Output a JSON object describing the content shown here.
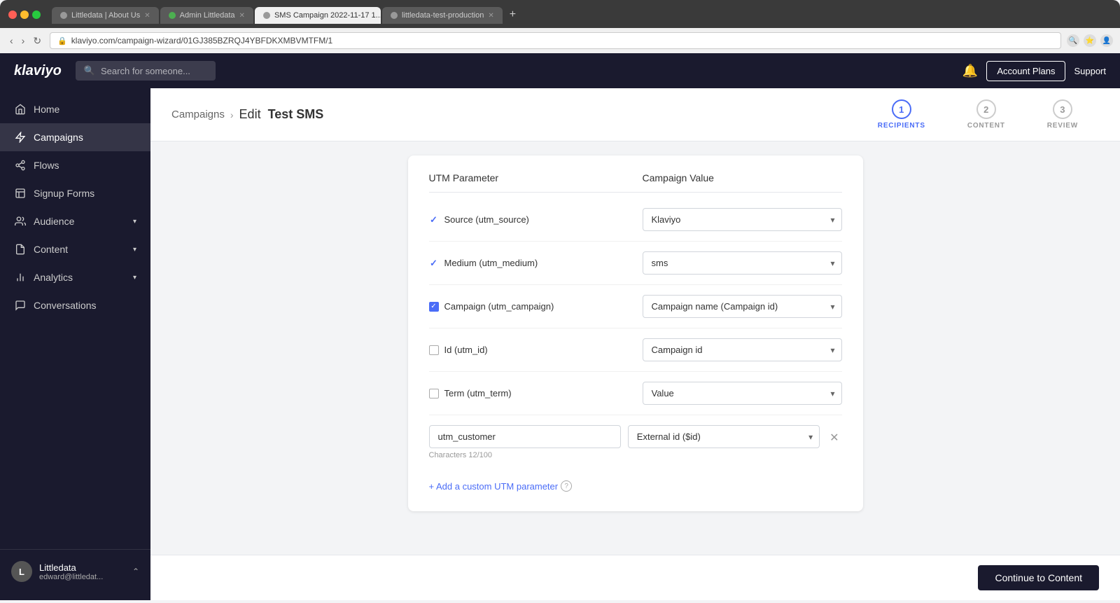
{
  "browser": {
    "tabs": [
      {
        "id": "tab1",
        "label": "Littledata | About Us",
        "dot_color": "gray",
        "active": false
      },
      {
        "id": "tab2",
        "label": "Admin Littledata",
        "dot_color": "green",
        "active": false
      },
      {
        "id": "tab3",
        "label": "SMS Campaign 2022-11-17 1...",
        "dot_color": "gray",
        "active": true
      },
      {
        "id": "tab4",
        "label": "littledata-test-production",
        "dot_color": "gray",
        "active": false
      }
    ],
    "url": "klaviyo.com/campaign-wizard/01GJ385BZRQJ4YBFDKXMBVMTFM/1"
  },
  "header": {
    "logo": "klaviyo",
    "search_placeholder": "Search for someone...",
    "account_plans_label": "Account Plans",
    "support_label": "Support"
  },
  "sidebar": {
    "items": [
      {
        "id": "home",
        "label": "Home",
        "icon": "home",
        "active": false,
        "has_chevron": false
      },
      {
        "id": "campaigns",
        "label": "Campaigns",
        "icon": "campaigns",
        "active": true,
        "has_chevron": false
      },
      {
        "id": "flows",
        "label": "Flows",
        "icon": "flows",
        "active": false,
        "has_chevron": false
      },
      {
        "id": "signup-forms",
        "label": "Signup Forms",
        "icon": "forms",
        "active": false,
        "has_chevron": false
      },
      {
        "id": "audience",
        "label": "Audience",
        "icon": "audience",
        "active": false,
        "has_chevron": true
      },
      {
        "id": "content",
        "label": "Content",
        "icon": "content",
        "active": false,
        "has_chevron": true
      },
      {
        "id": "analytics",
        "label": "Analytics",
        "icon": "analytics",
        "active": false,
        "has_chevron": true
      },
      {
        "id": "conversations",
        "label": "Conversations",
        "icon": "conversations",
        "active": false,
        "has_chevron": false
      }
    ],
    "user": {
      "name": "Littledata",
      "email": "edward@littledat...",
      "initials": "L"
    }
  },
  "page": {
    "breadcrumb_parent": "Campaigns",
    "breadcrumb_sep": "›",
    "breadcrumb_prefix": "Edit",
    "breadcrumb_bold": "Test SMS"
  },
  "steps": [
    {
      "number": "1",
      "label": "RECIPIENTS",
      "active": true
    },
    {
      "number": "2",
      "label": "CONTENT",
      "active": false
    },
    {
      "number": "3",
      "label": "REVIEW",
      "active": false
    }
  ],
  "utm_form": {
    "col_utm": "UTM Parameter",
    "col_campaign": "Campaign Value",
    "rows": [
      {
        "id": "source",
        "check_type": "checkmark",
        "label": "Source (utm_source)",
        "value": "Klaviyo"
      },
      {
        "id": "medium",
        "check_type": "checkmark",
        "label": "Medium (utm_medium)",
        "value": "sms"
      },
      {
        "id": "campaign",
        "check_type": "checkbox_checked",
        "label": "Campaign (utm_campaign)",
        "value": "Campaign name (Campaign id)"
      },
      {
        "id": "id",
        "check_type": "checkbox_unchecked",
        "label": "Id (utm_id)",
        "value": "Campaign id"
      },
      {
        "id": "term",
        "check_type": "checkbox_unchecked",
        "label": "Term (utm_term)",
        "value": "Value"
      }
    ],
    "custom_row": {
      "param_value": "utm_customer",
      "campaign_value": "External id ($id)",
      "char_count": "Characters 12/100"
    },
    "add_custom_label": "+ Add a custom UTM parameter"
  },
  "footer": {
    "continue_label": "Continue to Content"
  }
}
